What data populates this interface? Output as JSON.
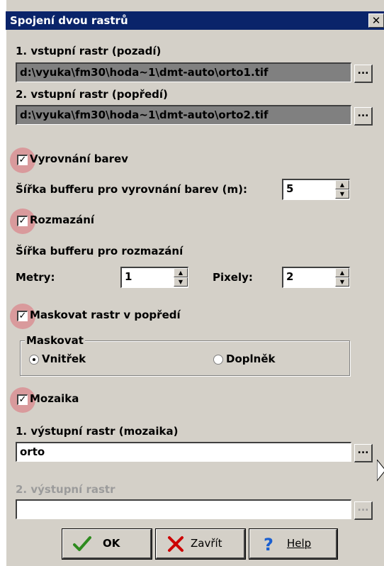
{
  "window": {
    "title": "Spojení dvou rastrů",
    "close_glyph": "✕"
  },
  "input1": {
    "label": "1. vstupní rastr (pozadí)",
    "value": "d:\\vyuka\\fm30\\hoda~1\\dmt-auto\\orto1.tif",
    "browse_label": "..."
  },
  "input2": {
    "label": "2. vstupní rastr (popředí)",
    "value": "d:\\vyuka\\fm30\\hoda~1\\dmt-auto\\orto2.tif",
    "browse_label": "..."
  },
  "color_balance": {
    "label": "Vyrovnání barev",
    "checked": true,
    "buffer_label": "Šířka bufferu pro vyrovnání barev (m):",
    "buffer_value": "5"
  },
  "blur": {
    "label": "Rozmazání",
    "checked": true,
    "buffer_label": "Šířka bufferu pro rozmazání",
    "meters_label": "Metry:",
    "meters_value": "1",
    "pixels_label": "Pixely:",
    "pixels_value": "2"
  },
  "mask": {
    "label": "Maskovat rastr v popředí",
    "checked": true,
    "group_label": "Maskovat",
    "options": [
      "Vnitřek",
      "Doplněk"
    ],
    "selected": "Vnitřek"
  },
  "mosaic": {
    "label": "Mozaika",
    "checked": true
  },
  "output1": {
    "label": "1. výstupní rastr (mozaika)",
    "value": "orto",
    "browse_label": "..."
  },
  "output2": {
    "label": "2. výstupní rastr",
    "value": "",
    "browse_label": "..."
  },
  "buttons": {
    "ok": "OK",
    "close": "Zavřít",
    "help": "Help"
  },
  "icons": {
    "ok": "checkmark-icon",
    "close": "x-mark-icon",
    "help": "question-icon"
  },
  "colors": {
    "titlebar": "#0a246a",
    "dialog": "#d4d0c8",
    "highlight": "#dc6e78",
    "ok_check": "#2e8b1f",
    "close_x": "#cc0000",
    "help_q": "#1a5fd0"
  }
}
